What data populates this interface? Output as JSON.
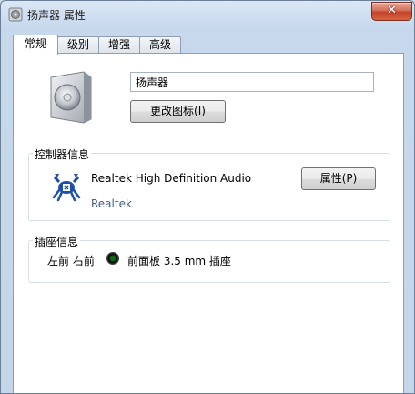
{
  "window": {
    "title": "扬声器 属性",
    "close_glyph": "✕"
  },
  "tabs": [
    {
      "label": "常规",
      "active": true
    },
    {
      "label": "级别",
      "active": false
    },
    {
      "label": "增强",
      "active": false
    },
    {
      "label": "高级",
      "active": false
    }
  ],
  "general": {
    "device_name_value": "扬声器",
    "change_icon_label": "更改图标(I)",
    "controller_group_label": "控制器信息",
    "controller_name": "Realtek High Definition Audio",
    "controller_vendor": "Realtek",
    "properties_button_label": "属性(P)",
    "jack_group_label": "插座信息",
    "jack_channels": "左前 右前",
    "jack_color": "#0b6b13",
    "jack_description": "前面板 3.5 mm 插座"
  },
  "icons": {
    "app": "speaker-icon",
    "device": "speaker-icon",
    "controller": "realtek-crab-icon",
    "jack": "audio-jack-icon"
  }
}
